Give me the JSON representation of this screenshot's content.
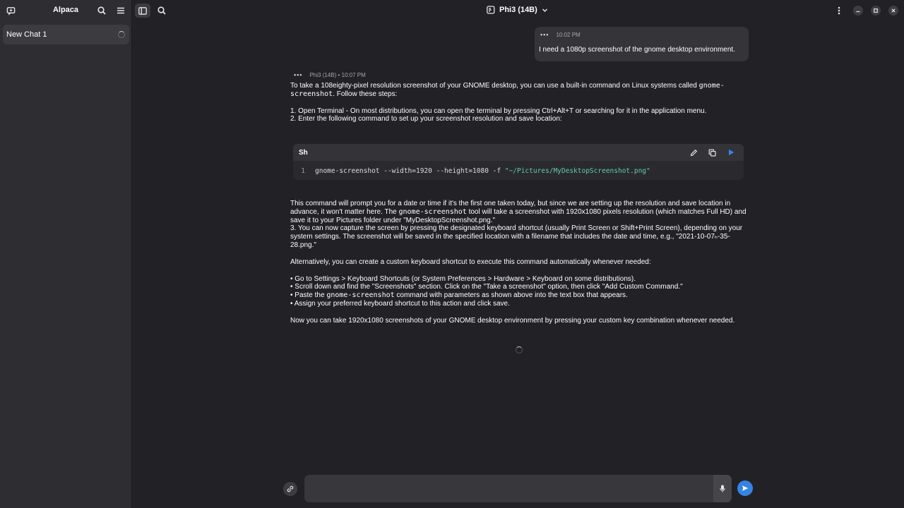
{
  "colors": {
    "accent": "#3584e4",
    "bg": "#222226",
    "sidebar": "#2e2e32"
  },
  "sidebar": {
    "title": "Alpaca",
    "icons": [
      "new-chat-icon",
      "search-icon",
      "menu-icon"
    ],
    "chats": [
      {
        "label": "New Chat 1"
      }
    ]
  },
  "header": {
    "model": "Phi3 (14B)",
    "icons": [
      "sidebar-toggle-icon",
      "search-icon",
      "model-manager-icon",
      "chevron-down-icon",
      "kebab-menu-icon",
      "minimize-icon",
      "maximize-icon",
      "close-icon"
    ]
  },
  "messages": {
    "user": {
      "time": "10:02 PM",
      "text": "I need a 1080p screenshot of the gnome desktop environment."
    },
    "bot": {
      "meta": "Phi3 (14B) • 10:07 PM",
      "intro_a": "To take a 108eighty-pixel resolution screenshot of your GNOME desktop, you can use a built-in command on Linux systems called ",
      "intro_code": "gnome-screenshot",
      "intro_b": ". Follow these steps:",
      "step1": "1. Open Terminal - On most distributions, you can open the terminal by pressing Ctrl+Alt+T or searching for it in the application menu.",
      "step2": "2. Enter the following command to set up your screenshot resolution and save location:",
      "code_lang": "Sh",
      "code_line_no": "1",
      "code_cmd": "gnome-screenshot --width=1920 --height=1080 -f ",
      "code_str": "\"~/Pictures/MyDesktopScreenshot.png\"",
      "para_a": "This command will prompt you for a date or time if it's the first one taken today, but since we are setting up the resolution and save location in advance, it won't matter here. The ",
      "para_code": "gnome-screenshot",
      "para_b": " tool will take a screenshot with 1920x1080 pixels resolution (which matches Full HD) and save it to your Pictures folder under \"MyDesktopScreenshot.png.\"",
      "step3": "3. You can now capture the screen by pressing the designated keyboard shortcut (usually Print Screen or Shift+Print Screen), depending on your system settings. The screenshot will be saved in the specified location with a filename that includes the date and time, e.g., \"2021-10-07ₕ-35-28.png.\"",
      "alt": "Alternatively, you can create a custom keyboard shortcut to execute this command automatically whenever needed:",
      "bullet1": "• Go to Settings > Keyboard Shortcuts (or System Preferences > Hardware > Keyboard on some distributions).",
      "bullet2": "• Scroll down and find the \"Screenshots\" section. Click on the \"Take a screenshot\" option, then click \"Add Custom Command.\"",
      "bullet3_a": "• Paste the ",
      "bullet3_code": "gnome-screenshot",
      "bullet3_b": " command with parameters as shown above into the text box that appears.",
      "bullet4": "• Assign your preferred keyboard shortcut to this action and click save.",
      "outro": "Now you can take 1920x1080 screenshots of your GNOME desktop environment by pressing your custom key combination whenever needed."
    }
  },
  "composer": {
    "placeholder": "",
    "value": ""
  }
}
